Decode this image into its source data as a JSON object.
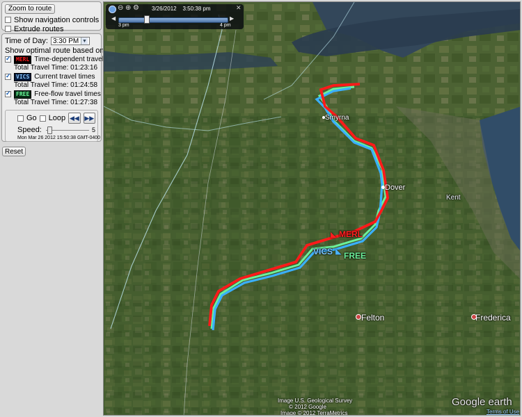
{
  "top_panel": {
    "zoom_button": "Zoom to route",
    "show_nav_label": "Show navigation controls",
    "extrude_label": "Extrude routes"
  },
  "main_panel": {
    "time_of_day_label": "Time of Day:",
    "time_of_day_value": "3:30 PM",
    "optimal_label": "Show optimal route based on:",
    "routes": [
      {
        "badge": "MERL",
        "label": "Time-dependent travel times",
        "total": "Total Travel Time: 01:23:16",
        "checked": true
      },
      {
        "badge": "VICS",
        "label": "Current travel times",
        "total": "Total Travel Time: 01:24:58",
        "checked": true
      },
      {
        "badge": "FREE",
        "label": "Free-flow travel times",
        "total": "Total Travel Time: 01:27:38",
        "checked": true
      }
    ],
    "go_label": "Go",
    "loop_label": "Loop",
    "speed_label": "Speed:",
    "speed_value": "5",
    "timestamp": "Mon Mar 26 2012 15:50:38 GMT-0400"
  },
  "reset_button": "Reset",
  "timebar": {
    "datetime": "3/26/2012    3:50:38 pm",
    "start": "3 pm",
    "end": "4 pm"
  },
  "map_labels": {
    "smyrna": "Smyrna",
    "dover": "Dover",
    "kent": "Kent",
    "felton": "Felton",
    "frederica": "Frederica",
    "route_merl": "MERL",
    "route_vics": "VICS",
    "route_free": "FREE",
    "credit1": "Image U.S. Geological Survey",
    "credit2": "© 2012 Google",
    "credit3": "Image © 2012 TerraMetrics",
    "brand": "Google earth",
    "terms": "Terms of Use"
  },
  "colors": {
    "merl": "#ff1a1a",
    "vics": "#3ab0ff",
    "free": "#6cf09a"
  }
}
